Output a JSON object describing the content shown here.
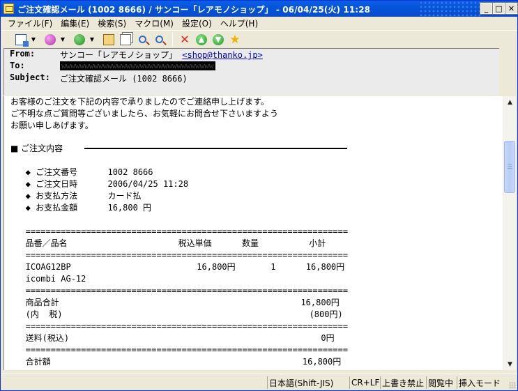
{
  "title_bar": {
    "title": "ご注文確認メール (1002 8666) / サンコー「レアモノショップ」 - 06/04/25(火) 11:28",
    "minimize": "_",
    "maximize": "□",
    "close": "✕"
  },
  "menu": {
    "items": [
      "ファイル(F)",
      "編集(E)",
      "検索(S)",
      "マクロ(M)",
      "設定(O)",
      "ヘルプ(H)"
    ]
  },
  "toolbar": {
    "icons": [
      "new-mail-icon",
      "receive-icon",
      "send-icon",
      "address-book-icon",
      "properties-icon",
      "find-icon",
      "find-next-icon",
      "delete-icon",
      "prev-message-icon",
      "next-message-icon",
      "mark-icon"
    ]
  },
  "header": {
    "from_label": "From:",
    "from_name": "サンコー「レアモノショップ」",
    "from_email": "<shop@thanko.jp>",
    "to_label": "To:",
    "to_value": "redacted",
    "subject_label": "Subject:",
    "subject_value": "ご注文確認メール (1002 8666)"
  },
  "body": {
    "text": "お客様のご注文を下記の内容で承りましたのでご連絡申し上げます。\nご不明な点ご質問等ございましたら、お気軽にお問合せ下さいますよう\nお願い申しあげます。",
    "section_title": "■ ご注文内容",
    "details": "   ◆ ご注文番号      1002 8666\n   ◆ ご注文日時      2006/04/25 11:28\n   ◆ お支払方法      カード払\n   ◆ お支払金額      16,800 円\n\n   ================================================================\n   品番／品名                      税込単価      数量          小計\n   ================================================================\n   ICOAG12BP                         16,800円       1      16,800円\n   icombi AG-12\n   ================================================================\n   商品合計                                                16,800円\n   (内  税)                                                 (800円)\n   ================================================================\n   送料(税込)                                                  0円\n   ================================================================\n   合計額                                                  16,800円"
  },
  "status_bar": {
    "encoding": "日本語(Shift-JIS)",
    "newline": "CR+LF",
    "overwrite": "上書き禁止",
    "view_mode": "閲覧中",
    "insert_mode": "挿入モード"
  }
}
